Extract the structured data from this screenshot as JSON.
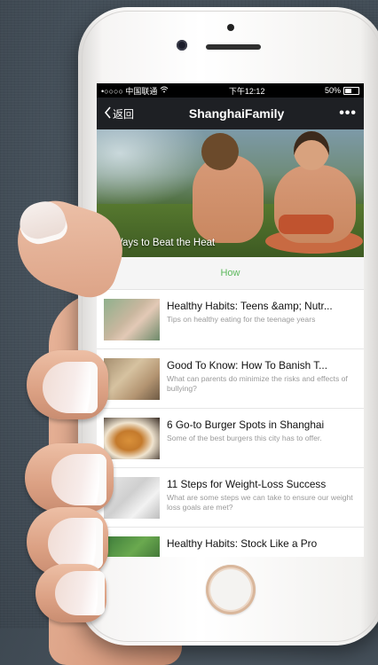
{
  "status_bar": {
    "carrier": "•○○○○ 中国联通",
    "wifi_icon": "wifi-icon",
    "time": "下午12:12",
    "battery": "50%"
  },
  "nav": {
    "back_label": "返回",
    "title": "ShanghaiFamily",
    "more_label": "•••"
  },
  "hero": {
    "caption": "5 Ways to Beat the Heat"
  },
  "section": {
    "header": "How"
  },
  "articles": [
    {
      "title": "Healthy Habits: Teens &amp; Nutr...",
      "desc": "Tips on healthy eating for the teenage years"
    },
    {
      "title": "Good To Know: How To Banish T...",
      "desc": "What can parents do minimize the risks and effects of bullying?"
    },
    {
      "title": "6 Go-to Burger Spots in Shanghai",
      "desc": "Some of the best burgers this city has to offer."
    },
    {
      "title": "11 Steps for Weight-Loss Success",
      "desc": "What are some steps we can take to ensure our weight loss goals are met?"
    },
    {
      "title": "Healthy Habits: Stock Like a Pro",
      "desc": ""
    }
  ],
  "colors": {
    "nav_bg": "#1e2024",
    "section_accent": "#5cb85c"
  }
}
